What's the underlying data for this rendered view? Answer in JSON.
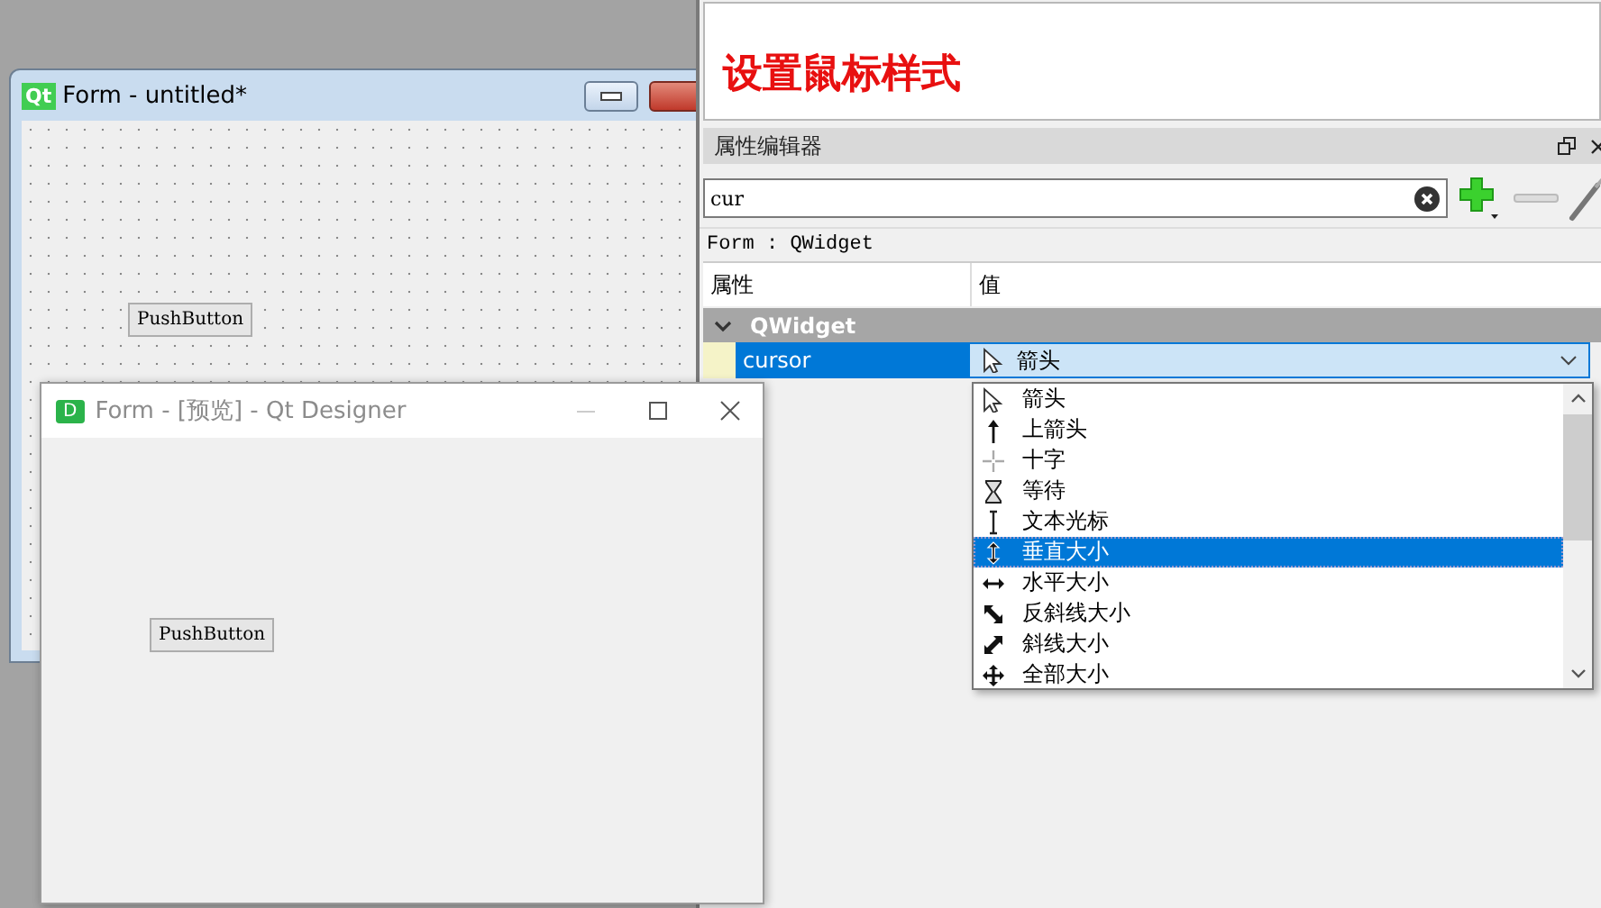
{
  "form_window": {
    "logo": "Qt",
    "title": "Form - untitled*",
    "button": "PushButton"
  },
  "annotation": {
    "text": "设置鼠标样式"
  },
  "property_editor": {
    "title": "属性编辑器",
    "filter": {
      "value": "cur"
    },
    "object_label": "Form : QWidget",
    "columns": [
      "属性",
      "值"
    ],
    "groups": [
      {
        "name": "QWidget",
        "expanded": true,
        "properties": [
          {
            "name": "cursor",
            "value": "箭头",
            "kind": "arrow",
            "selected": true
          }
        ]
      }
    ]
  },
  "cursor_menu": {
    "items": [
      {
        "label": "箭头",
        "kind": "arrow",
        "selected": false
      },
      {
        "label": "上箭头",
        "kind": "up-arrow",
        "selected": false
      },
      {
        "label": "十字",
        "kind": "cross",
        "selected": false
      },
      {
        "label": "等待",
        "kind": "wait",
        "selected": false
      },
      {
        "label": "文本光标",
        "kind": "ibeam",
        "selected": false
      },
      {
        "label": "垂直大小",
        "kind": "size-ver",
        "selected": true
      },
      {
        "label": "水平大小",
        "kind": "size-hor",
        "selected": false
      },
      {
        "label": "反斜线大小",
        "kind": "size-fdiag",
        "selected": false
      },
      {
        "label": "斜线大小",
        "kind": "size-bdiag",
        "selected": false
      },
      {
        "label": "全部大小",
        "kind": "size-all",
        "selected": false
      }
    ]
  },
  "preview_window": {
    "logo": "D",
    "title": "Form - [预览] - Qt Designer",
    "button": "PushButton"
  }
}
